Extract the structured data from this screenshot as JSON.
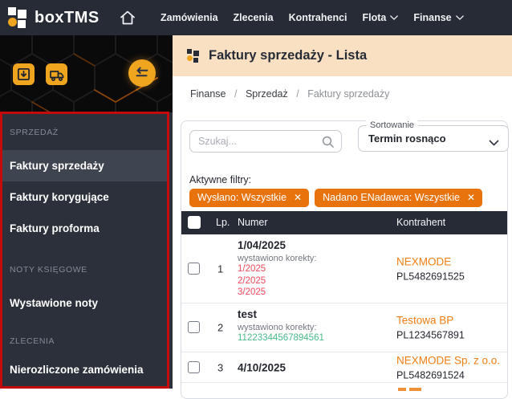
{
  "colors": {
    "dark_navy": "#262b36",
    "accent_amber": "#efa51e",
    "chip_orange": "#e8730d",
    "link_orange": "#ef7e14",
    "korekta_red": "#f2485a",
    "korekta_green": "#4bb98a",
    "annotation_red": "#c40b0b",
    "titlebar_peach": "#f9e0c2"
  },
  "navbar": {
    "brand": "boxTMS",
    "items": [
      {
        "label": "Zamówienia",
        "name": "zamowienia",
        "chevron": false
      },
      {
        "label": "Zlecenia",
        "name": "zlecenia",
        "chevron": false
      },
      {
        "label": "Kontrahenci",
        "name": "kontrahenci",
        "chevron": false
      },
      {
        "label": "Flota",
        "name": "flota",
        "chevron": true
      },
      {
        "label": "Finanse",
        "name": "finanse",
        "chevron": true
      }
    ]
  },
  "sidebar": {
    "icon_buttons": [
      "box-download",
      "truck",
      "swap-arrows"
    ],
    "sections": [
      {
        "label": "SPRZEDAŻ",
        "items": [
          {
            "label": "Faktury sprzedaży",
            "name": "faktury-sprzedazy",
            "active": true
          },
          {
            "label": "Faktury korygujące",
            "name": "faktury-korygujace",
            "active": false
          },
          {
            "label": "Faktury proforma",
            "name": "faktury-proforma",
            "active": false
          }
        ]
      },
      {
        "label": "NOTY KSIĘGOWE",
        "items": [
          {
            "label": "Wystawione noty",
            "name": "wystawione-noty",
            "active": false
          }
        ]
      },
      {
        "label": "ZLECENIA",
        "items": [
          {
            "label": "Nierozliczone zamówienia",
            "name": "nierozliczone-zamowienia",
            "active": false
          }
        ]
      }
    ]
  },
  "page": {
    "title": "Faktury sprzedaży - Lista",
    "breadcrumb": [
      "Finanse",
      "Sprzedaż",
      "Faktury sprzedaży"
    ]
  },
  "toolbar": {
    "search_placeholder": "Szukaj...",
    "sort_label": "Sortowanie",
    "sort_value": "Termin rosnąco"
  },
  "filters": {
    "label": "Aktywne filtry:",
    "chips": [
      "Wysłano: Wszystkie",
      "Nadano ENadawca: Wszystkie"
    ]
  },
  "table": {
    "columns": [
      "Lp.",
      "Numer",
      "Kontrahent"
    ],
    "rows": [
      {
        "lp": "1",
        "numer": "1/04/2025",
        "korekty_label": "wystawiono korekty:",
        "korekty": [
          "1/2025",
          "2/2025",
          "3/2025"
        ],
        "korekty_color": "red",
        "kontrahent": "NEXMODE",
        "nip": "PL5482691525"
      },
      {
        "lp": "2",
        "numer": "test",
        "korekty_label": "wystawiono korekty:",
        "korekty": [
          "11223344567894561"
        ],
        "korekty_color": "green",
        "kontrahent": "Testowa BP",
        "nip": "PL1234567891"
      },
      {
        "lp": "3",
        "numer": "4/10/2025",
        "korekty_label": "",
        "korekty": [],
        "korekty_color": "",
        "kontrahent": "NEXMODE Sp. z o.o.",
        "nip": "PL5482691524"
      }
    ]
  }
}
